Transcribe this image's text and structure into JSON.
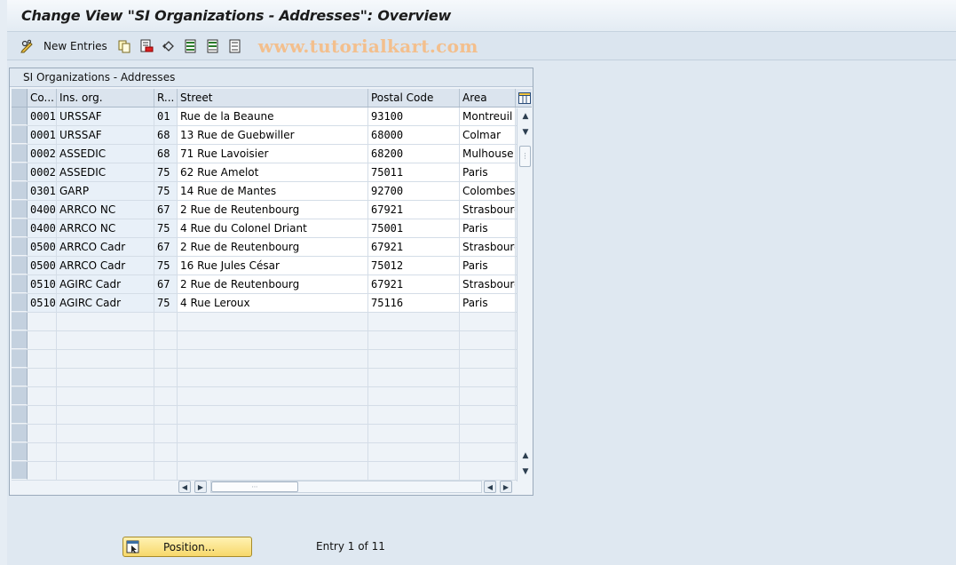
{
  "window": {
    "title": "Change View \"SI Organizations - Addresses\": Overview"
  },
  "toolbar": {
    "new_entries_label": "New Entries",
    "watermark": "www.tutorialkart.com"
  },
  "table": {
    "caption": "SI Organizations - Addresses",
    "columns": [
      "Co...",
      "Ins. org.",
      "R...",
      "Street",
      "Postal Code",
      "Area"
    ],
    "rows": [
      {
        "co": "0001",
        "ins": "URSSAF",
        "r": "01",
        "street": "Rue de la Beaune",
        "postal": "93100",
        "area": "Montreuil"
      },
      {
        "co": "0001",
        "ins": "URSSAF",
        "r": "68",
        "street": "13 Rue de Guebwiller",
        "postal": "68000",
        "area": "Colmar"
      },
      {
        "co": "0002",
        "ins": "ASSEDIC",
        "r": "68",
        "street": "71 Rue Lavoisier",
        "postal": "68200",
        "area": "Mulhouse"
      },
      {
        "co": "0002",
        "ins": "ASSEDIC",
        "r": "75",
        "street": "62 Rue Amelot",
        "postal": "75011",
        "area": "Paris"
      },
      {
        "co": "0301",
        "ins": "GARP",
        "r": "75",
        "street": "14 Rue de Mantes",
        "postal": "92700",
        "area": "Colombes"
      },
      {
        "co": "0400",
        "ins": "ARRCO NC",
        "r": "67",
        "street": "2 Rue de Reutenbourg",
        "postal": "67921",
        "area": "Strasbourg"
      },
      {
        "co": "0400",
        "ins": "ARRCO NC",
        "r": "75",
        "street": "4 Rue du Colonel Driant",
        "postal": "75001",
        "area": "Paris"
      },
      {
        "co": "0500",
        "ins": "ARRCO Cadr",
        "r": "67",
        "street": "2 Rue de Reutenbourg",
        "postal": "67921",
        "area": "Strasbourg"
      },
      {
        "co": "0500",
        "ins": "ARRCO Cadr",
        "r": "75",
        "street": "16 Rue Jules César",
        "postal": "75012",
        "area": "Paris"
      },
      {
        "co": "0510",
        "ins": "AGIRC Cadr",
        "r": "67",
        "street": "2 Rue de Reutenbourg",
        "postal": "67921",
        "area": "Strasbourg"
      },
      {
        "co": "0510",
        "ins": "AGIRC Cadr",
        "r": "75",
        "street": "4 Rue Leroux",
        "postal": "75116",
        "area": "Paris"
      }
    ]
  },
  "footer": {
    "position_label": "Position...",
    "entry_info": "Entry 1 of 11"
  },
  "colors": {
    "background": "#dfe8f1",
    "key_cell": "#e8f0f8",
    "button_gold": "#f7d86a",
    "watermark": "#f3bf8d"
  }
}
